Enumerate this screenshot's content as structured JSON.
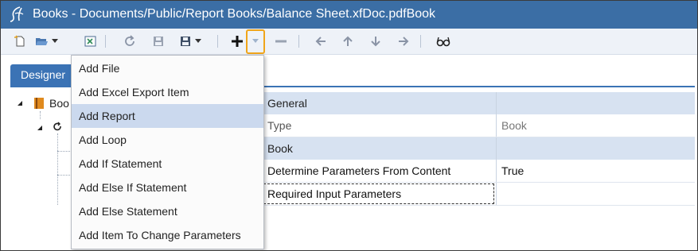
{
  "window": {
    "title": "Books - Documents/Public/Report Books/Balance Sheet.xfDoc.pdfBook"
  },
  "toolbar": {
    "buttons": [
      "new-icon",
      "open-icon",
      "open-dropdown-icon",
      "export-icon",
      "refresh-icon",
      "save-icon",
      "save-as-icon",
      "save-as-dropdown-icon",
      "add-icon",
      "add-dropdown-icon",
      "remove-icon",
      "move-left-icon",
      "move-up-icon",
      "move-down-icon",
      "move-right-icon",
      "preview-glasses-icon"
    ]
  },
  "tabs": {
    "designer": "Designer"
  },
  "tree": {
    "root_label": "Boo"
  },
  "menu": {
    "items": [
      "Add File",
      "Add Excel Export Item",
      "Add Report",
      "Add Loop",
      "Add If Statement",
      "Add Else If Statement",
      "Add Else Statement",
      "Add Item To Change Parameters"
    ],
    "selected_index": 2
  },
  "properties": {
    "sections": [
      {
        "name": "General",
        "rows": [
          {
            "name": "Type",
            "value": "Book"
          }
        ]
      },
      {
        "name": "Book",
        "rows": [
          {
            "name": "Determine Parameters From Content",
            "value": "True"
          },
          {
            "name": "Required Input Parameters",
            "value": ""
          }
        ]
      }
    ]
  },
  "colors": {
    "titlebar": "#3b6ea5",
    "accent": "#3b73b5",
    "highlight": "#f0a51a",
    "section": "#d7e2f1"
  }
}
